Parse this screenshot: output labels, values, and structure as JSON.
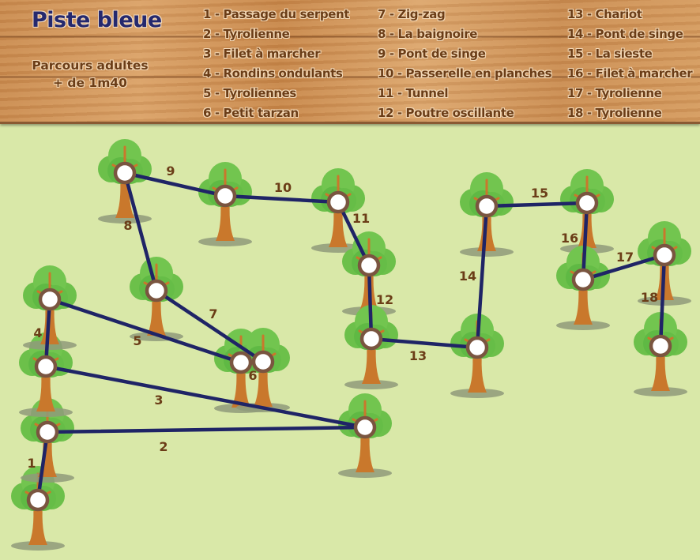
{
  "header": {
    "title": "Piste bleue",
    "subtitle_line1": "Parcours adultes",
    "subtitle_line2": "+ de 1m40"
  },
  "legend": {
    "columns": [
      [
        "1 - Passage du serpent",
        "2 - Tyrolienne",
        "3 - Filet à marcher",
        "4 - Rondins ondulants",
        "5 - Tyroliennes",
        "6 - Petit tarzan"
      ],
      [
        "7 - Zig-zag",
        "8 - La baignoire",
        "9 - Pont de singe",
        "10 - Passerelle en planches",
        "11 - Tunnel",
        "12 - Poutre oscillante"
      ],
      [
        "13 - Chariot",
        "14 - Pont de singe",
        "15 - La sieste",
        "16 - Filet à marcher",
        "17 - Tyrolienne",
        "18 - Tyrolienne"
      ]
    ]
  },
  "map": {
    "colors": {
      "ground": "#d9e8a8",
      "path": "#1f2466",
      "label": "#6b3d17",
      "foliage": "#6cc04a",
      "trunk": "#c9782c",
      "node_ring": "#7a5540"
    },
    "segments": [
      {
        "number": "1",
        "name": "Passage du serpent"
      },
      {
        "number": "2",
        "name": "Tyrolienne"
      },
      {
        "number": "3",
        "name": "Filet à marcher"
      },
      {
        "number": "4",
        "name": "Rondins ondulants"
      },
      {
        "number": "5",
        "name": "Tyroliennes"
      },
      {
        "number": "6",
        "name": "Petit tarzan"
      },
      {
        "number": "7",
        "name": "Zig-zag"
      },
      {
        "number": "8",
        "name": "La baignoire"
      },
      {
        "number": "9",
        "name": "Pont de singe"
      },
      {
        "number": "10",
        "name": "Passerelle en planches"
      },
      {
        "number": "11",
        "name": "Tunnel"
      },
      {
        "number": "12",
        "name": "Poutre oscillante"
      },
      {
        "number": "13",
        "name": "Chariot"
      },
      {
        "number": "14",
        "name": "Pont de singe"
      },
      {
        "number": "15",
        "name": "La sieste"
      },
      {
        "number": "16",
        "name": "Filet à marcher"
      },
      {
        "number": "17",
        "name": "Tyrolienne"
      },
      {
        "number": "18",
        "name": "Tyrolienne"
      }
    ]
  }
}
